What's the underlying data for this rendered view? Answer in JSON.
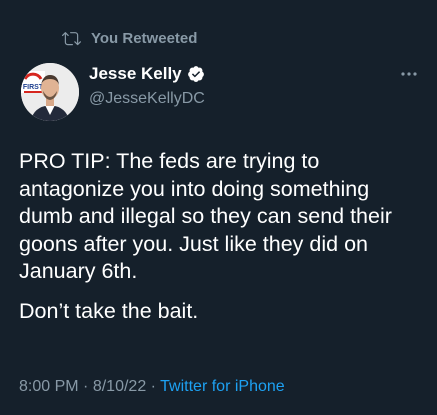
{
  "retweet": {
    "label": "You Retweeted",
    "icon": "retweet-icon"
  },
  "author": {
    "name": "Jesse Kelly",
    "handle": "@JesseKellyDC",
    "verified": true,
    "avatar_badge": "FIRST"
  },
  "tweet": {
    "paragraphs": [
      "PRO TIP: The feds are trying to antagonize you into doing something dumb and illegal so they can send their goons after you. Just like they did on January 6th.",
      "Don’t take the bait."
    ],
    "time": "8:00 PM",
    "date": "8/10/22",
    "separator": "·",
    "source": "Twitter for iPhone"
  },
  "colors": {
    "background": "#15202b",
    "text": "#ffffff",
    "muted": "#8899a6",
    "accent": "#1da1f2"
  }
}
